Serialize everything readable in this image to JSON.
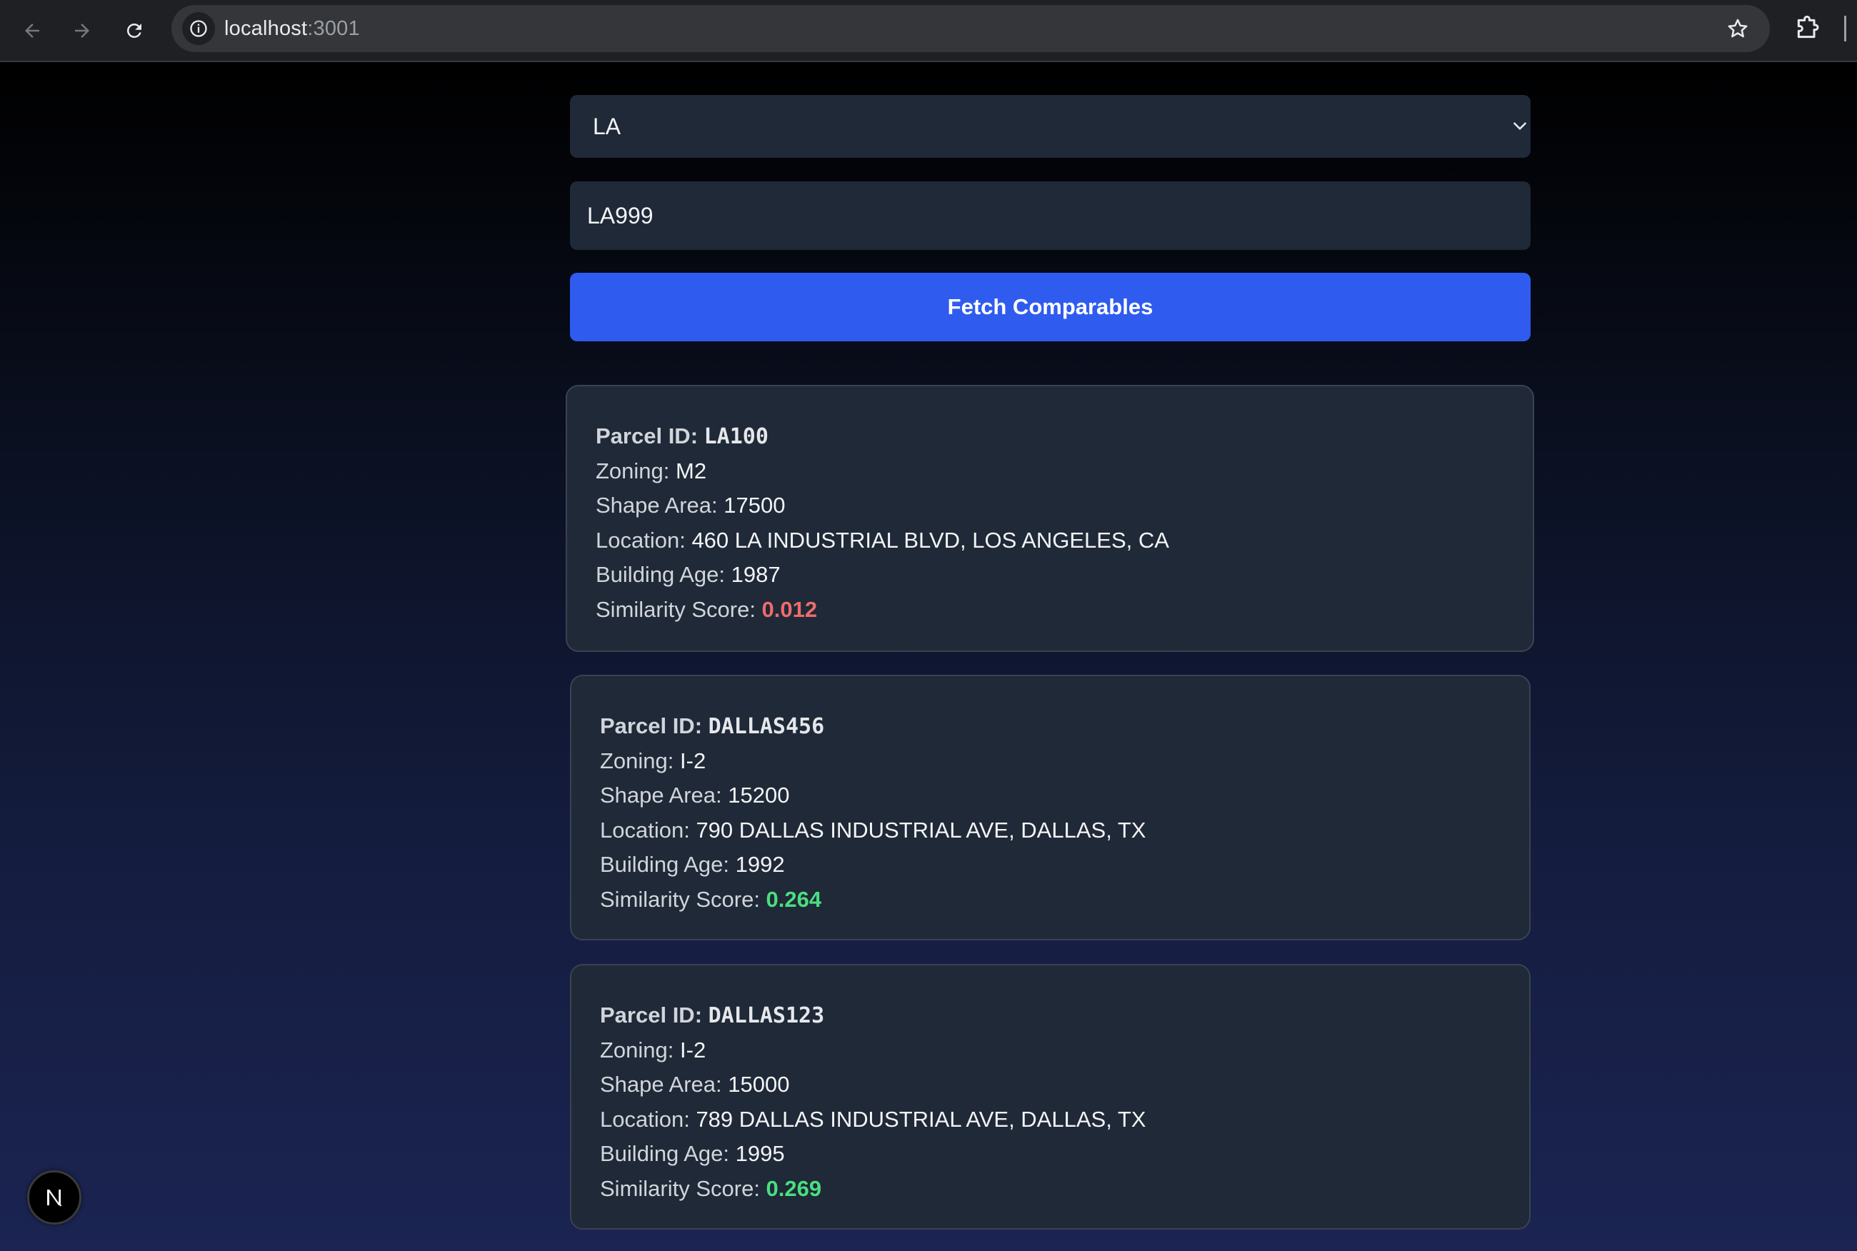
{
  "browser": {
    "url_host": "localhost",
    "url_port": ":3001"
  },
  "form": {
    "city_select": "LA",
    "parcel_input": "LA999",
    "fetch_label": "Fetch Comparables"
  },
  "labels": {
    "parcel_id": "Parcel ID: ",
    "zoning": "Zoning: ",
    "shape_area": "Shape Area: ",
    "location": "Location: ",
    "building_age": "Building Age: ",
    "similarity": "Similarity Score: "
  },
  "results": [
    {
      "parcel_id": "LA100",
      "zoning": "M2",
      "shape_area": "17500",
      "location": "460 LA INDUSTRIAL BLVD, LOS ANGELES, CA",
      "building_age": "1987",
      "similarity": "0.012"
    },
    {
      "parcel_id": "DALLAS456",
      "zoning": "I-2",
      "shape_area": "15200",
      "location": "790 DALLAS INDUSTRIAL AVE, DALLAS, TX",
      "building_age": "1992",
      "similarity": "0.264"
    },
    {
      "parcel_id": "DALLAS123",
      "zoning": "I-2",
      "shape_area": "15000",
      "location": "789 DALLAS INDUSTRIAL AVE, DALLAS, TX",
      "building_age": "1995",
      "similarity": "0.269"
    }
  ],
  "colors": {
    "button_blue": "#2f5cef",
    "card_bg": "#1f2937",
    "score_low": "#ef6b6b",
    "score_ok": "#4ade80"
  },
  "icons": [
    "back-arrow-icon",
    "forward-arrow-icon",
    "reload-icon",
    "info-icon",
    "star-icon",
    "extensions-icon",
    "chevron-down-icon",
    "nextjs-logo-icon"
  ]
}
